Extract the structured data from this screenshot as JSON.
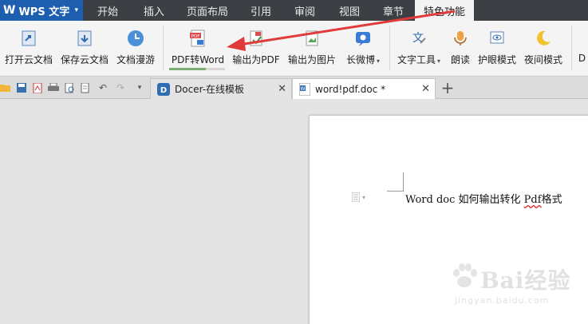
{
  "app": {
    "logo": "W",
    "name": "WPS 文字",
    "caret": "▾"
  },
  "menu": [
    {
      "label": "开始",
      "active": false
    },
    {
      "label": "插入",
      "active": false
    },
    {
      "label": "页面布局",
      "active": false
    },
    {
      "label": "引用",
      "active": false
    },
    {
      "label": "审阅",
      "active": false
    },
    {
      "label": "视图",
      "active": false
    },
    {
      "label": "章节",
      "active": false
    },
    {
      "label": "特色功能",
      "active": true
    }
  ],
  "ribbon": {
    "open_cloud": "打开云文档",
    "save_cloud": "保存云文档",
    "roam": "文档漫游",
    "pdf_to_word": "PDF转Word",
    "pdf_icon_text": "PDF",
    "export_pdf": "输出为PDF",
    "export_image": "输出为图片",
    "long_weibo": "长微博",
    "text_tools": "文字工具",
    "read_aloud": "朗读",
    "eye_mode": "护眼模式",
    "night_mode": "夜间模式",
    "docer_cut": "D",
    "pdf_to_word_progress": 0.65
  },
  "tabs": {
    "docer": {
      "label": "Docer-在线模板",
      "close": "✕"
    },
    "doc": {
      "label": "word!pdf.doc *",
      "close": "✕"
    },
    "add": "+"
  },
  "document": {
    "text_main": "Word doc 如何输出转化 ",
    "text_squiggle": "Pdf",
    "text_end": "格式"
  },
  "watermark": {
    "brand": "Bai经验",
    "url": "jingyan.baidu.com"
  },
  "colors": {
    "app_blue": "#1d5fae",
    "menubar": "#3c3f44",
    "arrow_red": "#e03a3a",
    "progress_green": "#7cae72"
  }
}
